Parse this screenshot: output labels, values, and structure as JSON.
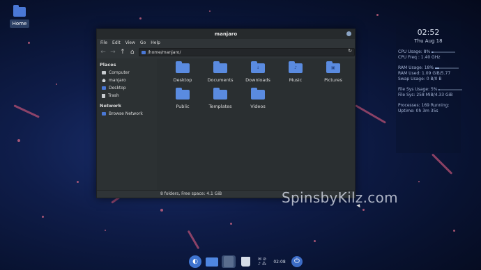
{
  "desktop": {
    "home_label": "Home"
  },
  "window": {
    "title": "manjaro",
    "menu": [
      "File",
      "Edit",
      "View",
      "Go",
      "Help"
    ],
    "path": "/home/manjaro/",
    "sidebar": {
      "places_header": "Places",
      "places": [
        "Computer",
        "manjaro",
        "Desktop",
        "Trash"
      ],
      "network_header": "Network",
      "network": [
        "Browse Network"
      ]
    },
    "folders": [
      "Desktop",
      "Documents",
      "Downloads",
      "Music",
      "Pictures",
      "Public",
      "Templates",
      "Videos"
    ],
    "status": "8 folders, Free space: 4.1 GiB"
  },
  "conky": {
    "time": "02:52",
    "date": "Thu Aug 18",
    "cpu_usage": "CPU Usage: 8%",
    "cpu_freq": "CPU Freq : 1.40 GHz",
    "ram_usage": "RAM Usage: 18%",
    "ram_used": "RAM Used: 1.09 GiB/5.77",
    "swap_usage": "Swap Usage: 0 B/0 B",
    "fs_usage": "File Sys Usage:  5%",
    "fs_used": "File Sys: 258 MiB/4.33 GiB",
    "processes": "Processes: 169  Running:",
    "uptime": "Uptime: 0h 3m 35s",
    "cpu_level": 0.08,
    "ram_level": 0.18,
    "fs_level": 0.05
  },
  "watermark": "SpinsbyKilz.com",
  "dock": {
    "clock": "02:08"
  },
  "colors": {
    "accent": "#4a78d6",
    "window_bg": "#2f3437"
  },
  "icons": [
    "folder-icon",
    "computer-icon",
    "home-icon",
    "trash-icon",
    "network-icon",
    "back-icon",
    "forward-icon",
    "up-icon",
    "home-nav-icon",
    "reload-icon",
    "close-icon",
    "power-icon"
  ]
}
